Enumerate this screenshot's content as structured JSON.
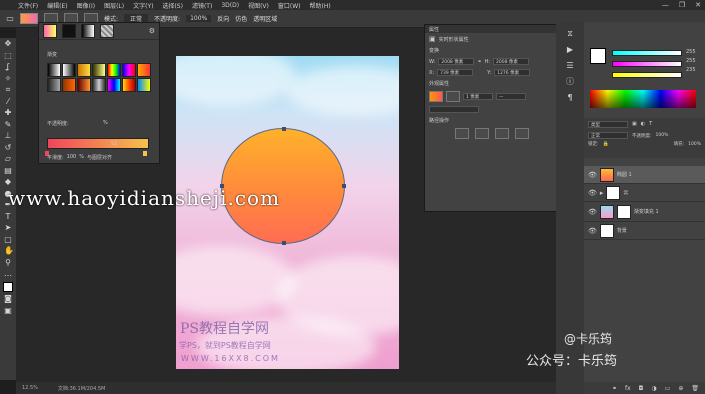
{
  "menu": {
    "items": [
      "文件(F)",
      "编辑(E)",
      "图像(I)",
      "图层(L)",
      "文字(Y)",
      "选择(S)",
      "滤镜(T)",
      "3D(D)",
      "视图(V)",
      "窗口(W)",
      "帮助(H)"
    ]
  },
  "options_bar": {
    "mode_label": "模式:",
    "mode_value": "正常",
    "opacity_label": "不透明度:",
    "opacity_value": "100%",
    "reverse_label": "反向",
    "dither_label": "仿色",
    "transparency_label": "透明区域"
  },
  "gradient_editor": {
    "title": "渐变",
    "smoothness_label": "平滑度:",
    "smoothness_value": "100",
    "opacity_label": "不透明度:",
    "location_label": "位置:",
    "location_value": "52",
    "percent": "%",
    "apply_label": "与图层对齐"
  },
  "properties": {
    "title": "属性",
    "subtitle": "实时形状属性",
    "section_transform": "变换",
    "w_label": "W:",
    "w_value": "2008 像素",
    "h_label": "H:",
    "h_value": "2008 像素",
    "x_label": "X:",
    "x_value": "739 像素",
    "y_label": "Y:",
    "y_value": "1276 像素",
    "section_appearance": "外观属性",
    "stroke_value": "1 像素",
    "section_path": "路径操作"
  },
  "layers": {
    "search_placeholder": "类型",
    "blend_mode": "正常",
    "opacity_label": "不透明度:",
    "opacity_value": "100%",
    "lock_label": "锁定:",
    "fill_label": "填充:",
    "fill_value": "100%",
    "items": [
      {
        "name": "椭圆 1"
      },
      {
        "name": "云"
      },
      {
        "name": "渐变填充 1"
      },
      {
        "name": "背景"
      }
    ]
  },
  "color_panel": {
    "r_value": "255",
    "g_value": "255",
    "b_value": "235"
  },
  "status": {
    "zoom": "12.5%",
    "doc_info": "文档:36.1M/204.5M"
  },
  "canvas_watermark": {
    "line1": "PS教程自学网",
    "line2": "学PS，就到PS教程自学网",
    "line3": "WWW.16XX8.COM"
  },
  "site_watermark": "www.haoyidiansheji.com",
  "author_watermark": {
    "line1": "@卡乐筠",
    "line2": "公众号：卡乐筠"
  },
  "colors": {
    "circle_top": "#ffb12b",
    "circle_bottom": "#ff6c52",
    "sky_top": "#9fdcf3",
    "sky_bottom": "#ef9fcf"
  }
}
